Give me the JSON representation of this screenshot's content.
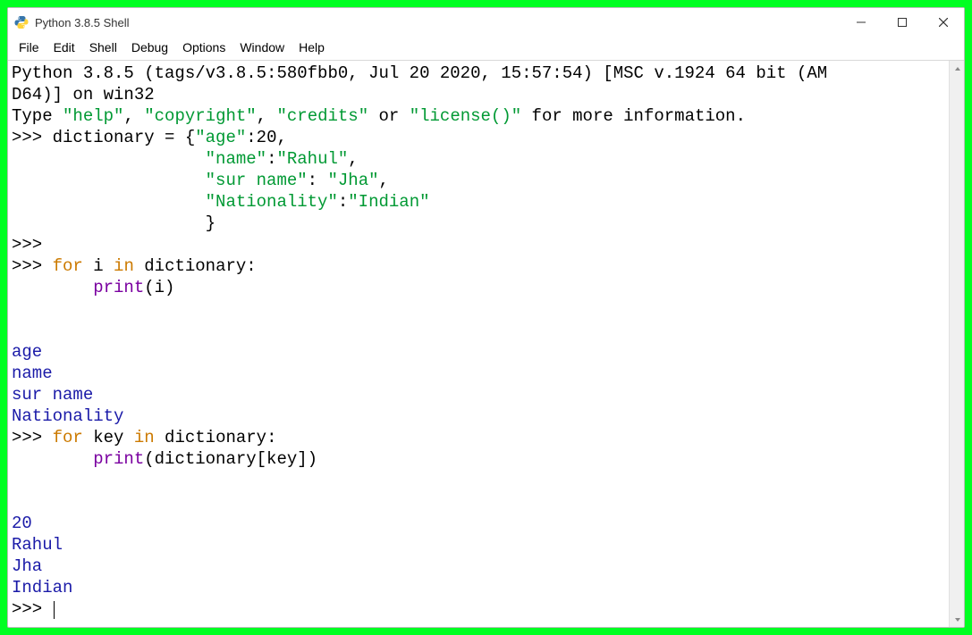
{
  "window": {
    "title": "Python 3.8.5 Shell"
  },
  "menu": {
    "items": [
      "File",
      "Edit",
      "Shell",
      "Debug",
      "Options",
      "Window",
      "Help"
    ]
  },
  "shell": {
    "banner_line1": "Python 3.8.5 (tags/v3.8.5:580fbb0, Jul 20 2020, 15:57:54) [MSC v.1924 64 bit (AM",
    "banner_line2": "D64)] on win32",
    "banner_line3_pre": "Type ",
    "banner_line3_s1": "\"help\"",
    "banner_line3_m1": ", ",
    "banner_line3_s2": "\"copyright\"",
    "banner_line3_m2": ", ",
    "banner_line3_s3": "\"credits\"",
    "banner_line3_m3": " or ",
    "banner_line3_s4": "\"license()\"",
    "banner_line3_post": " for more information.",
    "prompt": ">>> ",
    "continuation_pad": "                   ",
    "dict_line1_pre": "dictionary = {",
    "dict_key1": "\"age\"",
    "dict_val1": ":20,",
    "dict_key2": "\"name\"",
    "dict_mid2": ":",
    "dict_val2s": "\"Rahul\"",
    "dict_end2": ",",
    "dict_key3": "\"sur name\"",
    "dict_mid3": ": ",
    "dict_val3s": "\"Jha\"",
    "dict_end3": ",",
    "dict_key4": "\"Nationality\"",
    "dict_mid4": ":",
    "dict_val4s": "\"Indian\"",
    "dict_close_pad": "                   ",
    "dict_close": "}",
    "for1_for": "for",
    "for1_var": " i ",
    "for1_in": "in",
    "for1_rest": " dictionary:",
    "for1_body_pad": "        ",
    "for1_print": "print",
    "for1_print_args": "(i)",
    "out1_1": "age",
    "out1_2": "name",
    "out1_3": "sur name",
    "out1_4": "Nationality",
    "for2_for": "for",
    "for2_var": " key ",
    "for2_in": "in",
    "for2_rest": " dictionary:",
    "for2_body_pad": "        ",
    "for2_print": "print",
    "for2_print_args": "(dictionary[key])",
    "out2_1": "20",
    "out2_2": "Rahul",
    "out2_3": "Jha",
    "out2_4": "Indian"
  }
}
